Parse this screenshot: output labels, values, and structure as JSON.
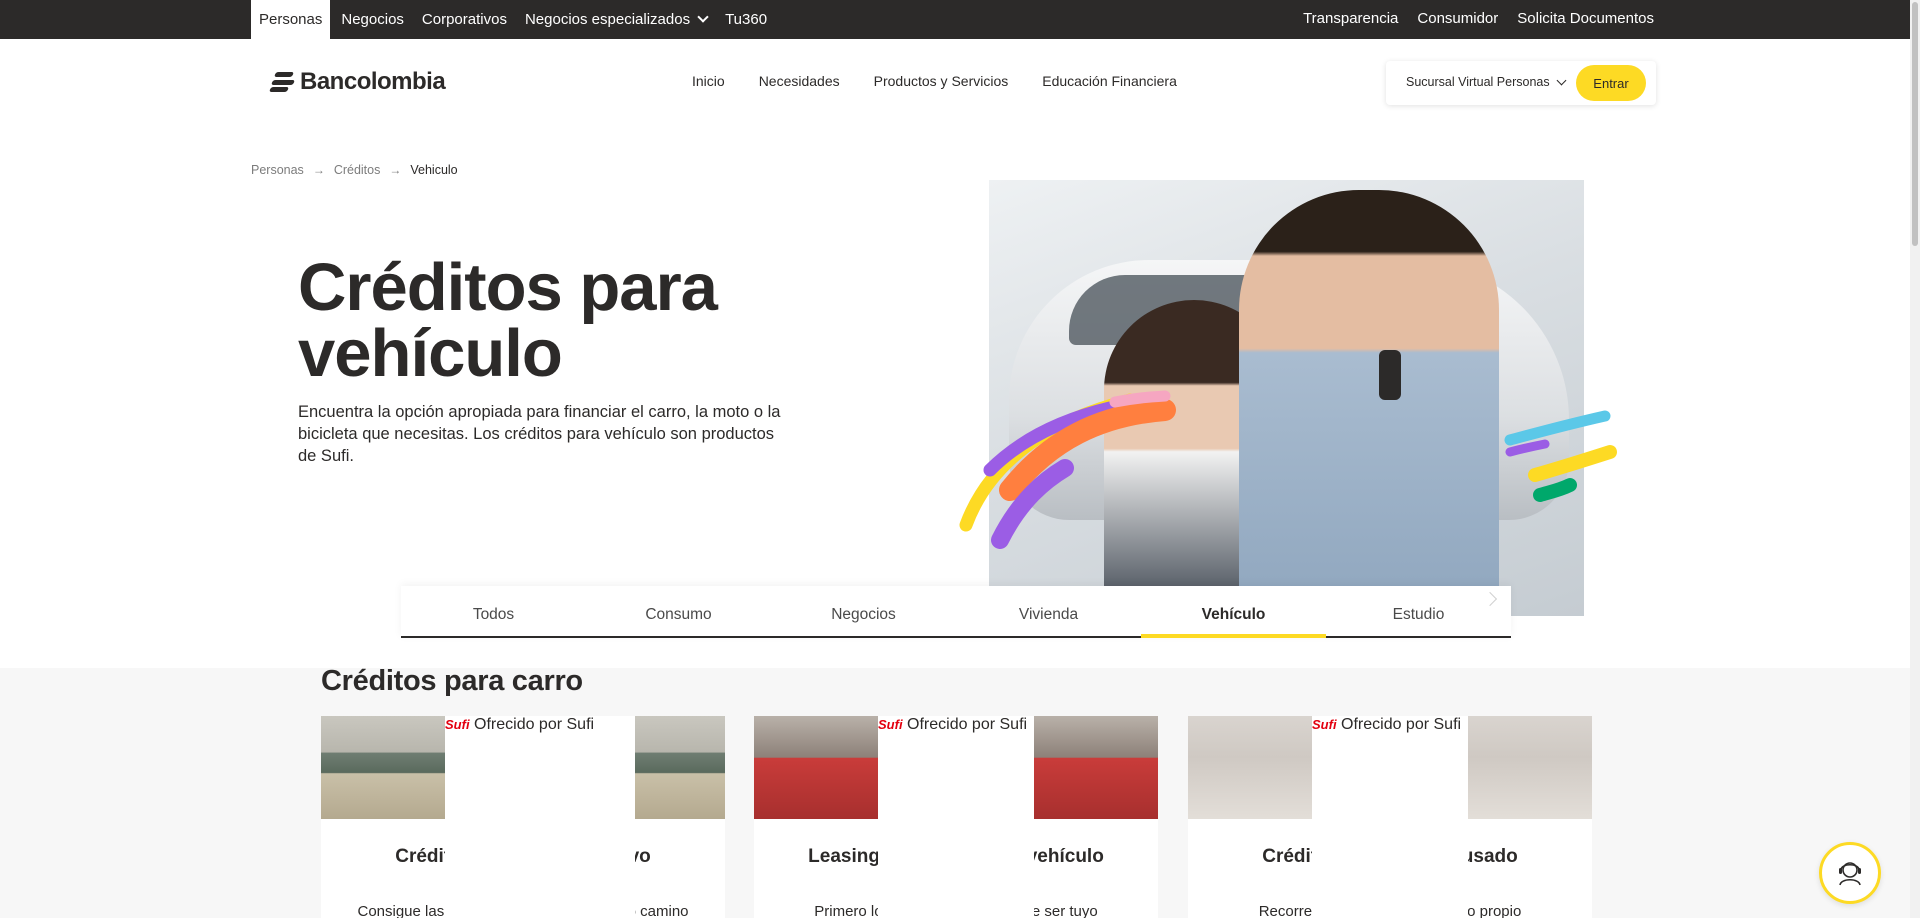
{
  "topbar": {
    "left_items": [
      "Personas",
      "Negocios",
      "Corporativos",
      "Negocios especializados",
      "Tu360"
    ],
    "right_items": [
      "Transparencia",
      "Consumidor",
      "Solicita Documentos"
    ]
  },
  "header": {
    "logo": "Bancolombia",
    "nav": [
      "Inicio",
      "Necesidades",
      "Productos y Servicios",
      "Educación Financiera"
    ],
    "sucursal_label": "Sucursal Virtual Personas",
    "entrar_label": "Entrar"
  },
  "breadcrumb": {
    "items": [
      "Personas",
      "Créditos",
      "Vehiculo"
    ]
  },
  "hero": {
    "title": "Créditos para vehículo",
    "description": "Encuentra la opción apropiada para financiar el carro, la moto o la bicicleta que necesitas. Los créditos para vehículo son productos de Sufi."
  },
  "tabs": {
    "items": [
      "Todos",
      "Consumo",
      "Negocios",
      "Vivienda",
      "Vehículo",
      "Estudio"
    ],
    "active": "Vehículo"
  },
  "section": {
    "title": "Créditos para carro",
    "cards": [
      {
        "badge_brand": "Sufi",
        "badge_text": "Ofrecido por Sufi",
        "title": "Crédito para vehículo nuevo",
        "description": "Consigue las llaves y emprende un nuevo camino"
      },
      {
        "badge_brand": "Sufi",
        "badge_text": "Ofrecido por Sufi",
        "title": "Leasing financiero para vehículo",
        "description": "Primero lo arriendas, luego puede ser tuyo"
      },
      {
        "badge_brand": "Sufi",
        "badge_text": "Ofrecido por Sufi",
        "title": "Crédito para vehículo usado",
        "description": "Recorre el camino hacia tu carro propio"
      }
    ]
  },
  "colors": {
    "brand_yellow": "#fdda24",
    "dark": "#2c2a29",
    "sufi_red": "#e3000f"
  },
  "icons": [
    "chevron-down-icon",
    "arrow-right-icon",
    "chevron-right-icon",
    "help-agent-icon"
  ]
}
